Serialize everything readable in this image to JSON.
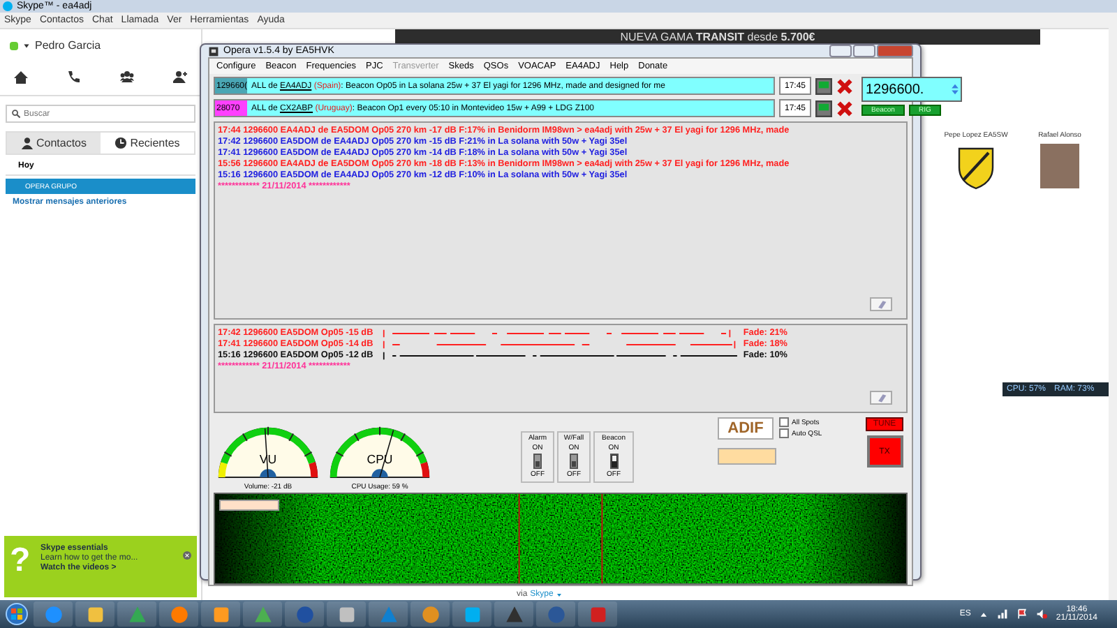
{
  "skype": {
    "title": "Skype™ - ea4adj",
    "menu": [
      "Skype",
      "Contactos",
      "Chat",
      "Llamada",
      "Ver",
      "Herramientas",
      "Ayuda"
    ],
    "profile": {
      "name": "Pedro Garcia"
    },
    "search": {
      "placeholder": "Buscar"
    },
    "tabs": [
      {
        "label": "Contactos",
        "selected": false
      },
      {
        "label": "Recientes",
        "selected": true
      }
    ],
    "section": "Hoy",
    "conversations": [
      {
        "label": "OPERA GRUPO",
        "selected": true
      }
    ],
    "more_link": "Mostrar mensajes anteriores",
    "essentials": {
      "icon": "?",
      "title": "Skype essentials",
      "text": "Learn how to get the mo...",
      "link": "Watch the videos >"
    },
    "ad": {
      "text": "NUEVA GAMA **TRANSIT** desde **5.700€**"
    },
    "contacts": [
      {
        "name": "Pepe Lopez EA5SW",
        "kind": "emblem"
      },
      {
        "name": "Rafael Alonso",
        "kind": "photo"
      }
    ],
    "via": {
      "label": "via",
      "link": "Skype"
    }
  },
  "opera": {
    "title": "Opera v1.5.4   by EA5HVK",
    "menu": [
      {
        "label": "Configure",
        "disabled": false
      },
      {
        "label": "Beacon",
        "disabled": false
      },
      {
        "label": "Frequencies",
        "disabled": false
      },
      {
        "label": "PJC",
        "disabled": false
      },
      {
        "label": "Transverter",
        "disabled": true
      },
      {
        "label": "Skeds",
        "disabled": false
      },
      {
        "label": "QSOs",
        "disabled": false
      },
      {
        "label": "VOACAP",
        "disabled": false
      },
      {
        "label": "EA4ADJ",
        "disabled": false
      },
      {
        "label": "Help",
        "disabled": false
      },
      {
        "label": "Donate",
        "disabled": false
      }
    ],
    "messages": [
      {
        "freq": "129660(",
        "color": "#4aa6b4",
        "prefix": "ALL de",
        "call": "EA4ADJ",
        "country": "(Spain)",
        "text": ": Beacon Op05 in La solana 25w + 37 El yagi for 1296 MHz, made and designed for me",
        "time": "17:45"
      },
      {
        "freq": "28070",
        "color": "#ff40ff",
        "prefix": "ALL de",
        "call": "CX2ABP",
        "country": "(Uruguay)",
        "text": ": Beacon Op1 every 05:10 in Montevideo 15w + A99 + LDG Z100",
        "time": "17:45"
      }
    ],
    "frequency": "1296600.",
    "buttons": [
      "Beacon",
      "RIG"
    ],
    "log": [
      {
        "text": "17:44 1296600 EA4ADJ de EA5DOM Op05 270 km -17 dB F:17% in Benidorm IM98wn > ea4adj with 25w + 37 El yagi for 1296 MHz, made",
        "color": "#ff2020"
      },
      {
        "text": "17:42 1296600 EA5DOM de EA4ADJ Op05 270 km -15 dB F:21% in La solana with 50w + Yagi 35el",
        "color": "#2020e0"
      },
      {
        "text": "17:41 1296600 EA5DOM de EA4ADJ Op05 270 km -14 dB F:18% in La solana with 50w + Yagi 35el",
        "color": "#2020e0"
      },
      {
        "text": "15:56 1296600 EA4ADJ de EA5DOM Op05 270 km -18 dB F:13% in Benidorm IM98wn > ea4adj with 25w + 37 El yagi for 1296 MHz, made",
        "color": "#ff2020"
      },
      {
        "text": "15:16 1296600 EA5DOM de EA4ADJ Op05 270 km -12 dB F:10% in La solana with 50w + Yagi 35el",
        "color": "#2020e0"
      }
    ],
    "log_date": "************  21/11/2014  ************",
    "fades": [
      {
        "text": "17:42 1296600 EA5DOM Op05 -15 dB",
        "fade": "Fade: 21%",
        "color": "#ff2020"
      },
      {
        "text": "17:41 1296600 EA5DOM Op05 -14 dB",
        "fade": "Fade: 18%",
        "color": "#ff2020"
      },
      {
        "text": "15:16 1296600 EA5DOM Op05 -12 dB",
        "fade": "Fade: 10%",
        "color": "#101010"
      }
    ],
    "fade_date": "************  21/11/2014  ************",
    "meters": [
      {
        "label": "VU",
        "reading": "Volume: -21 dB",
        "level": 0.48
      },
      {
        "label": "CPU",
        "reading": "CPU Usage: 59 %",
        "level": 0.59
      }
    ],
    "switches": [
      {
        "label": "Alarm",
        "on_label": "ON",
        "off_label": "OFF",
        "on": false
      },
      {
        "label": "W/Fall",
        "on_label": "ON",
        "off_label": "OFF",
        "on": false
      },
      {
        "label": "Beacon",
        "on_label": "ON",
        "off_label": "OFF",
        "on": true
      }
    ],
    "adif": "ADIF",
    "checkboxes": [
      {
        "label": "All Spots",
        "checked": false
      },
      {
        "label": "Auto QSL",
        "checked": false
      }
    ],
    "tune": "TUNE",
    "tx": "TX"
  },
  "monitor": {
    "cpu": "CPU: 57%",
    "ram": "RAM: 73%"
  },
  "tray": {
    "language": "ES",
    "time": "18:46",
    "date": "21/11/2014"
  }
}
